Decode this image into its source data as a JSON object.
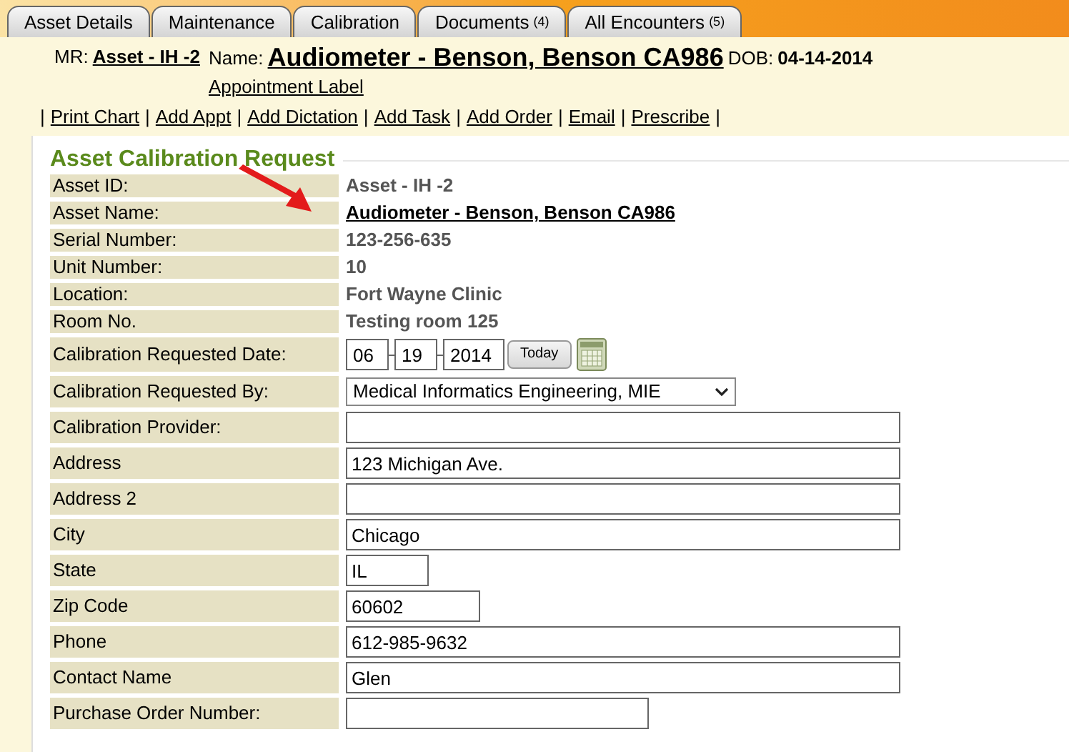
{
  "tabs": [
    {
      "label": "Asset Details"
    },
    {
      "label": "Maintenance"
    },
    {
      "label": "Calibration"
    },
    {
      "label": "Documents",
      "count": "(4)"
    },
    {
      "label": "All Encounters",
      "count": "(5)"
    }
  ],
  "header": {
    "mr_label": "MR:",
    "mr_value": "Asset - IH -2",
    "name_label": "Name:",
    "name_value": "Audiometer - Benson, Benson CA986",
    "dob_label": "DOB:",
    "dob_value": "04-14-2014",
    "appointment_link": "Appointment Label"
  },
  "actions": {
    "separator": "|",
    "links": [
      "Print Chart",
      "Add Appt",
      "Add Dictation",
      "Add Task",
      "Add Order",
      "Email",
      "Prescribe"
    ]
  },
  "form": {
    "title": "Asset Calibration Request",
    "rows": [
      {
        "kind": "text",
        "label": "Asset ID:",
        "value": "Asset - IH -2"
      },
      {
        "kind": "link",
        "label": "Asset Name:",
        "value": "Audiometer - Benson, Benson CA986"
      },
      {
        "kind": "text",
        "label": "Serial Number:",
        "value": "123-256-635"
      },
      {
        "kind": "text",
        "label": "Unit Number:",
        "value": "10"
      },
      {
        "kind": "text",
        "label": "Location:",
        "value": "Fort Wayne Clinic"
      },
      {
        "kind": "text",
        "label": "Room No.",
        "value": "Testing room 125"
      },
      {
        "kind": "date",
        "label": "Calibration Requested Date:",
        "month": "06",
        "day": "19",
        "year": "2014",
        "button": "Today"
      },
      {
        "kind": "select",
        "label": "Calibration Requested By:",
        "value": "Medical Informatics Engineering, MIE"
      },
      {
        "kind": "widefield",
        "label": "Calibration Provider:"
      },
      {
        "kind": "widefield",
        "label": "Address",
        "value": "123 Michigan Ave."
      },
      {
        "kind": "widefield",
        "label": "Address 2"
      },
      {
        "kind": "widefield",
        "label": "City",
        "value": "Chicago"
      },
      {
        "kind": "tinyfield",
        "label": "State",
        "value": "IL"
      },
      {
        "kind": "smallfield",
        "label": "Zip Code",
        "value": "60602"
      },
      {
        "kind": "widefield",
        "label": "Phone",
        "value": "612-985-9632"
      },
      {
        "kind": "widefield",
        "label": "Contact Name",
        "value": "Glen"
      },
      {
        "kind": "midfield",
        "label": "Purchase Order Number:"
      }
    ]
  }
}
